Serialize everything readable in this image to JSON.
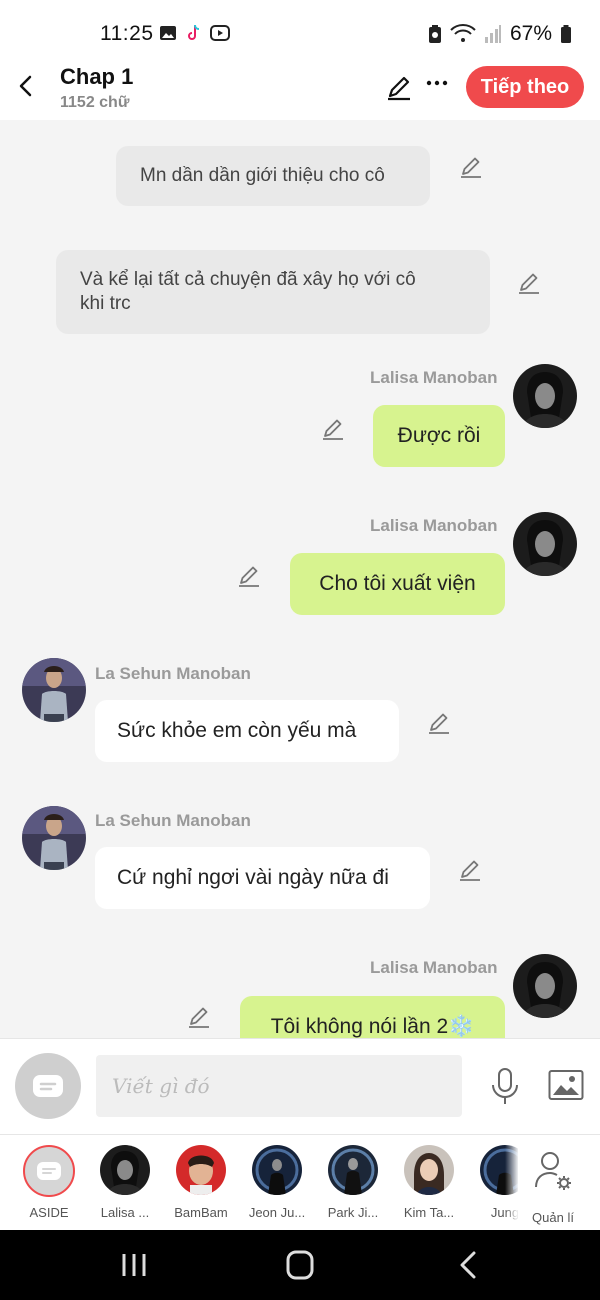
{
  "status_bar": {
    "time": "11:25",
    "battery": "67%"
  },
  "header": {
    "title": "Chap 1",
    "word_count": "1152 chữ",
    "next_label": "Tiếp theo"
  },
  "messages": [
    {
      "type": "narration",
      "text": "Mn dần dần giới thiệu cho cô"
    },
    {
      "type": "narration",
      "lines": [
        "Và kể lại tất cả chuyện đã xây họ với cô",
        "khi trc"
      ]
    },
    {
      "type": "right",
      "sender": "Lalisa Manoban",
      "text": "Được rồi"
    },
    {
      "type": "right",
      "sender": "Lalisa Manoban",
      "text": "Cho tôi xuất viện"
    },
    {
      "type": "left",
      "sender": "La Sehun Manoban",
      "text": "Sức khỏe em còn yếu mà"
    },
    {
      "type": "left",
      "sender": "La Sehun Manoban",
      "text": "Cứ nghỉ ngơi vài ngày nữa đi"
    },
    {
      "type": "right",
      "sender": "Lalisa Manoban",
      "text": "Tôi không nói lần 2",
      "emoji": "❄️"
    }
  ],
  "input": {
    "placeholder": "Viết gì đó"
  },
  "characters": [
    {
      "label": "ASIDE"
    },
    {
      "label": "Lalisa ..."
    },
    {
      "label": "BamBam"
    },
    {
      "label": "Jeon Ju..."
    },
    {
      "label": "Park Ji..."
    },
    {
      "label": "Kim Ta..."
    },
    {
      "label": "Jung"
    }
  ],
  "manage_label": "Quản lí",
  "icons": {
    "back": "back-arrow-icon",
    "edit": "pencil-icon",
    "more": "more-dots-icon",
    "mic": "microphone-icon",
    "image": "image-icon",
    "manage": "user-settings-icon"
  },
  "colors": {
    "accent": "#f04a4c",
    "green_bubble": "#d7f38f",
    "narration_bg": "#e9e9e9",
    "chat_bg": "#f4f4f4"
  }
}
